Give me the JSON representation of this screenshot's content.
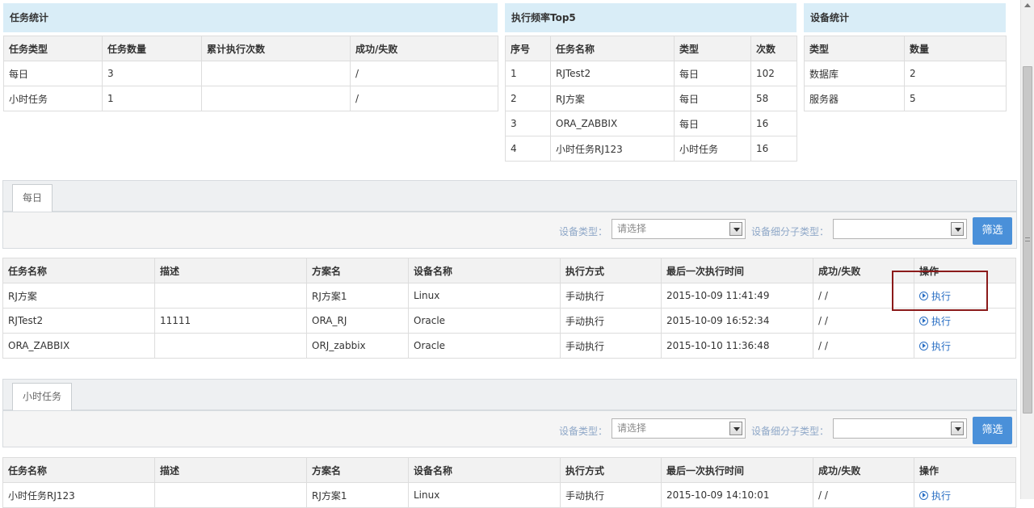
{
  "task_stats": {
    "title": "任务统计",
    "headers": [
      "任务类型",
      "任务数量",
      "累计执行次数",
      "成功/失败"
    ],
    "rows": [
      [
        "每日",
        "3",
        "",
        "/"
      ],
      [
        "小时任务",
        "1",
        "",
        "/"
      ]
    ]
  },
  "top5": {
    "title": "执行频率Top5",
    "headers": [
      "序号",
      "任务名称",
      "类型",
      "次数"
    ],
    "rows": [
      [
        "1",
        "RJTest2",
        "每日",
        "102"
      ],
      [
        "2",
        "RJ方案",
        "每日",
        "58"
      ],
      [
        "3",
        "ORA_ZABBIX",
        "每日",
        "16"
      ],
      [
        "4",
        "小时任务RJ123",
        "小时任务",
        "16"
      ]
    ]
  },
  "device_stats": {
    "title": "设备统计",
    "headers": [
      "类型",
      "数量"
    ],
    "rows": [
      [
        "数据库",
        "2"
      ],
      [
        "服务器",
        "5"
      ]
    ]
  },
  "daily": {
    "tab_label": "每日",
    "filter": {
      "device_type_label": "设备类型：",
      "device_type_value": "请选择",
      "subtype_label": "设备细分子类型：",
      "subtype_value": "",
      "button": "筛选"
    },
    "headers": [
      "任务名称",
      "描述",
      "方案名",
      "设备名称",
      "执行方式",
      "最后一次执行时间",
      "成功/失败",
      "操作"
    ],
    "rows": [
      [
        "RJ方案",
        "",
        "RJ方案1",
        "Linux",
        "手动执行",
        "2015-10-09 11:41:49",
        "/ /",
        "执行"
      ],
      [
        "RJTest2",
        "11111",
        "ORA_RJ",
        "Oracle",
        "手动执行",
        "2015-10-09 16:52:34",
        "/ /",
        "执行"
      ],
      [
        "ORA_ZABBIX",
        "",
        "ORJ_zabbix",
        "Oracle",
        "手动执行",
        "2015-10-10 11:36:48",
        "/ /",
        "执行"
      ]
    ]
  },
  "hourly": {
    "tab_label": "小时任务",
    "filter": {
      "device_type_label": "设备类型：",
      "device_type_value": "请选择",
      "subtype_label": "设备细分子类型：",
      "subtype_value": "",
      "button": "筛选"
    },
    "headers": [
      "任务名称",
      "描述",
      "方案名",
      "设备名称",
      "执行方式",
      "最后一次执行时间",
      "成功/失败",
      "操作"
    ],
    "rows": [
      [
        "小时任务RJ123",
        "",
        "RJ方案1",
        "Linux",
        "手动执行",
        "2015-10-09 14:10:01",
        "/ /",
        "执行"
      ]
    ]
  },
  "colors": {
    "panel_header": "#d9edf7",
    "button": "#4a90d9",
    "link": "#2a6fc4",
    "highlight_box": "#8b1a1a"
  }
}
